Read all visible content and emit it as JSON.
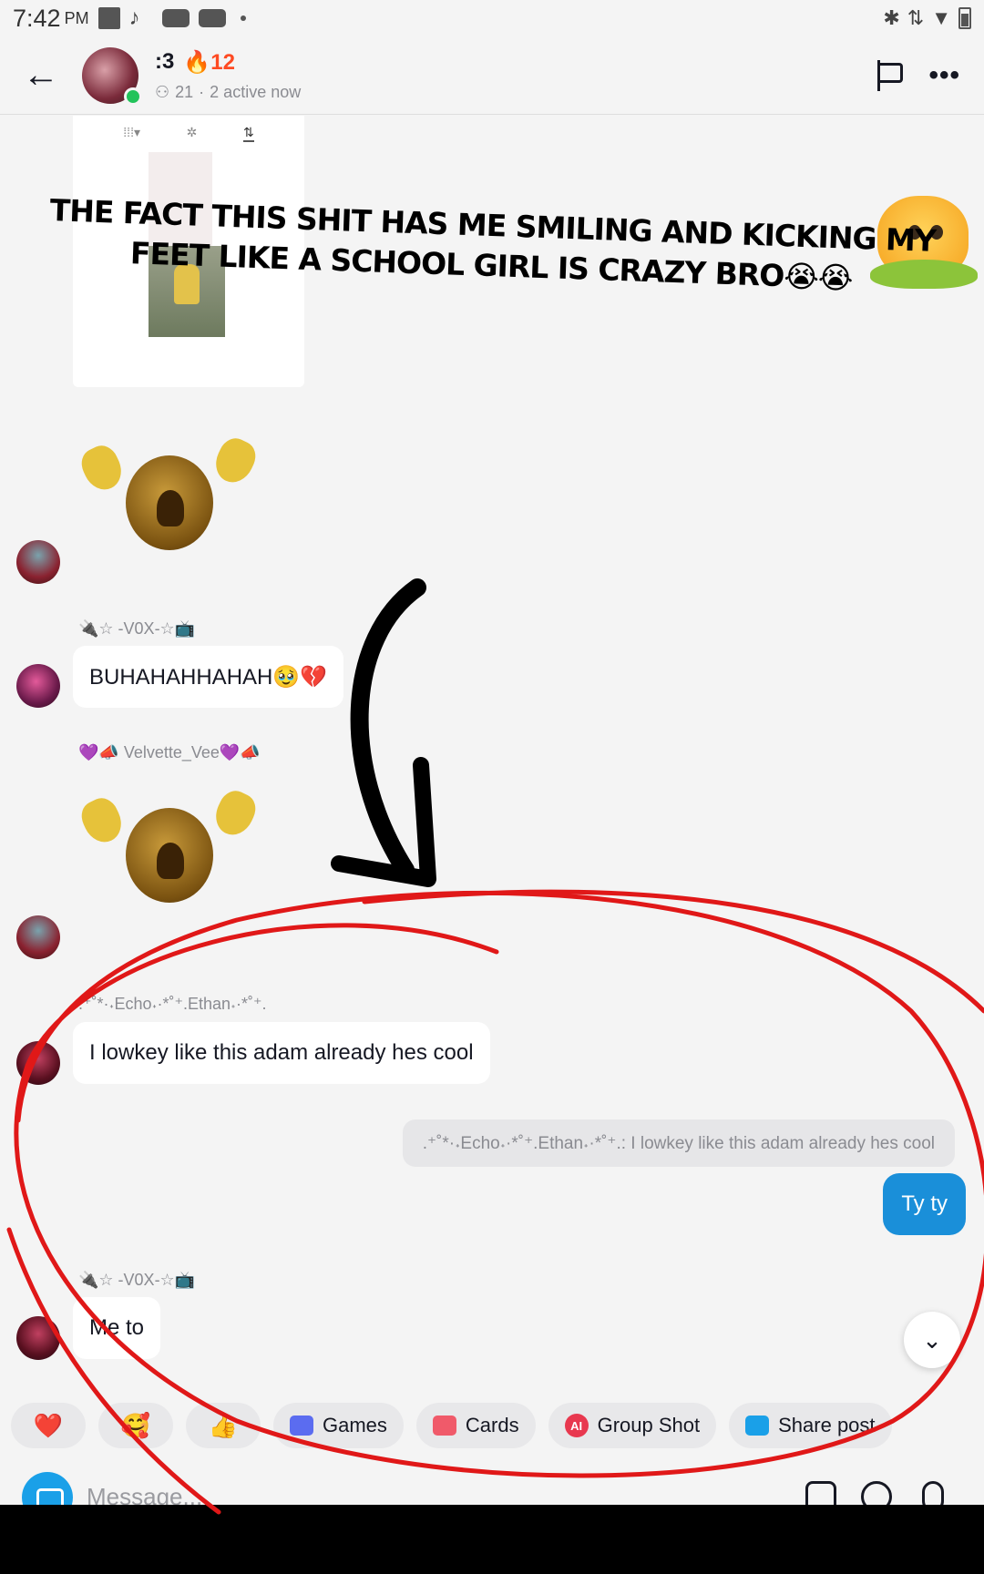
{
  "status_bar": {
    "time": "7:42",
    "ampm": "PM"
  },
  "header": {
    "title": ":3",
    "streak_emoji": "🔥",
    "streak": "12",
    "member_count": "21",
    "separator": "·",
    "active": "2 active now"
  },
  "shared_card": {
    "tabs": [
      "⁞⁞⁞▾",
      "✲",
      "⇅"
    ]
  },
  "overlay_caption": "THE FACT THIS SHIT HAS ME SMILING AND KICKING MY FEET LIKE A SCHOOL GIRL IS CRAZY BRO😭😭",
  "messages": [
    {
      "sender": "🔌☆ -V0X-☆📺",
      "text": "BUHAHAHHAHAH🥹💔"
    },
    {
      "sender": "💜📣 Velvette_Vee💜📣"
    },
    {
      "sender": ".⁺˚*·˖Echo˖·*˚⁺.Ethan˖·*˚⁺.",
      "text": "I lowkey like this adam already hes cool"
    },
    {
      "quote": ".⁺˚*·˖Echo˖·*˚⁺.Ethan˖·*˚⁺.: I lowkey like this adam already hes cool",
      "text": "Ty ty"
    },
    {
      "sender": "🔌☆ -V0X-☆📺",
      "text": "Me to"
    }
  ],
  "quick_actions": {
    "emoji": [
      "❤️",
      "🥰",
      "👍"
    ],
    "games": "Games",
    "cards": "Cards",
    "group_shot": "Group Shot",
    "share_post": "Share post"
  },
  "input": {
    "placeholder": "Message..."
  },
  "colors": {
    "accent": "#1a8fd9",
    "streak": "#fe4a22",
    "online": "#22c35a",
    "annotation": "#e01818"
  }
}
